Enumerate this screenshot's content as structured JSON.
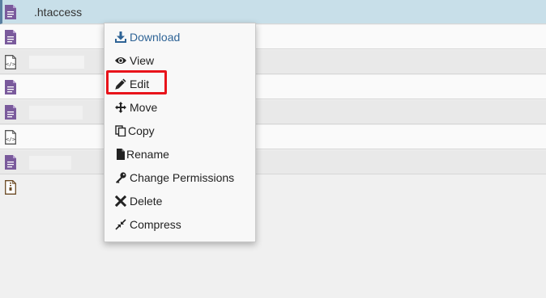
{
  "file_list": {
    "selected_file": ".htaccess"
  },
  "context_menu": {
    "items": [
      {
        "label": "Download",
        "icon": "download-icon"
      },
      {
        "label": "View",
        "icon": "eye-icon"
      },
      {
        "label": "Edit",
        "icon": "pencil-icon"
      },
      {
        "label": "Move",
        "icon": "move-arrows-icon"
      },
      {
        "label": "Copy",
        "icon": "copy-icon"
      },
      {
        "label": "Rename",
        "icon": "file-icon"
      },
      {
        "label": "Change Permissions",
        "icon": "key-icon"
      },
      {
        "label": "Delete",
        "icon": "x-icon"
      },
      {
        "label": "Compress",
        "icon": "compress-icon"
      }
    ]
  },
  "colors": {
    "selected_row": "#c8dfe9",
    "file_icon_purple": "#7a5a9c",
    "download_link": "#2f6496",
    "highlight_box": "#e8131a"
  }
}
